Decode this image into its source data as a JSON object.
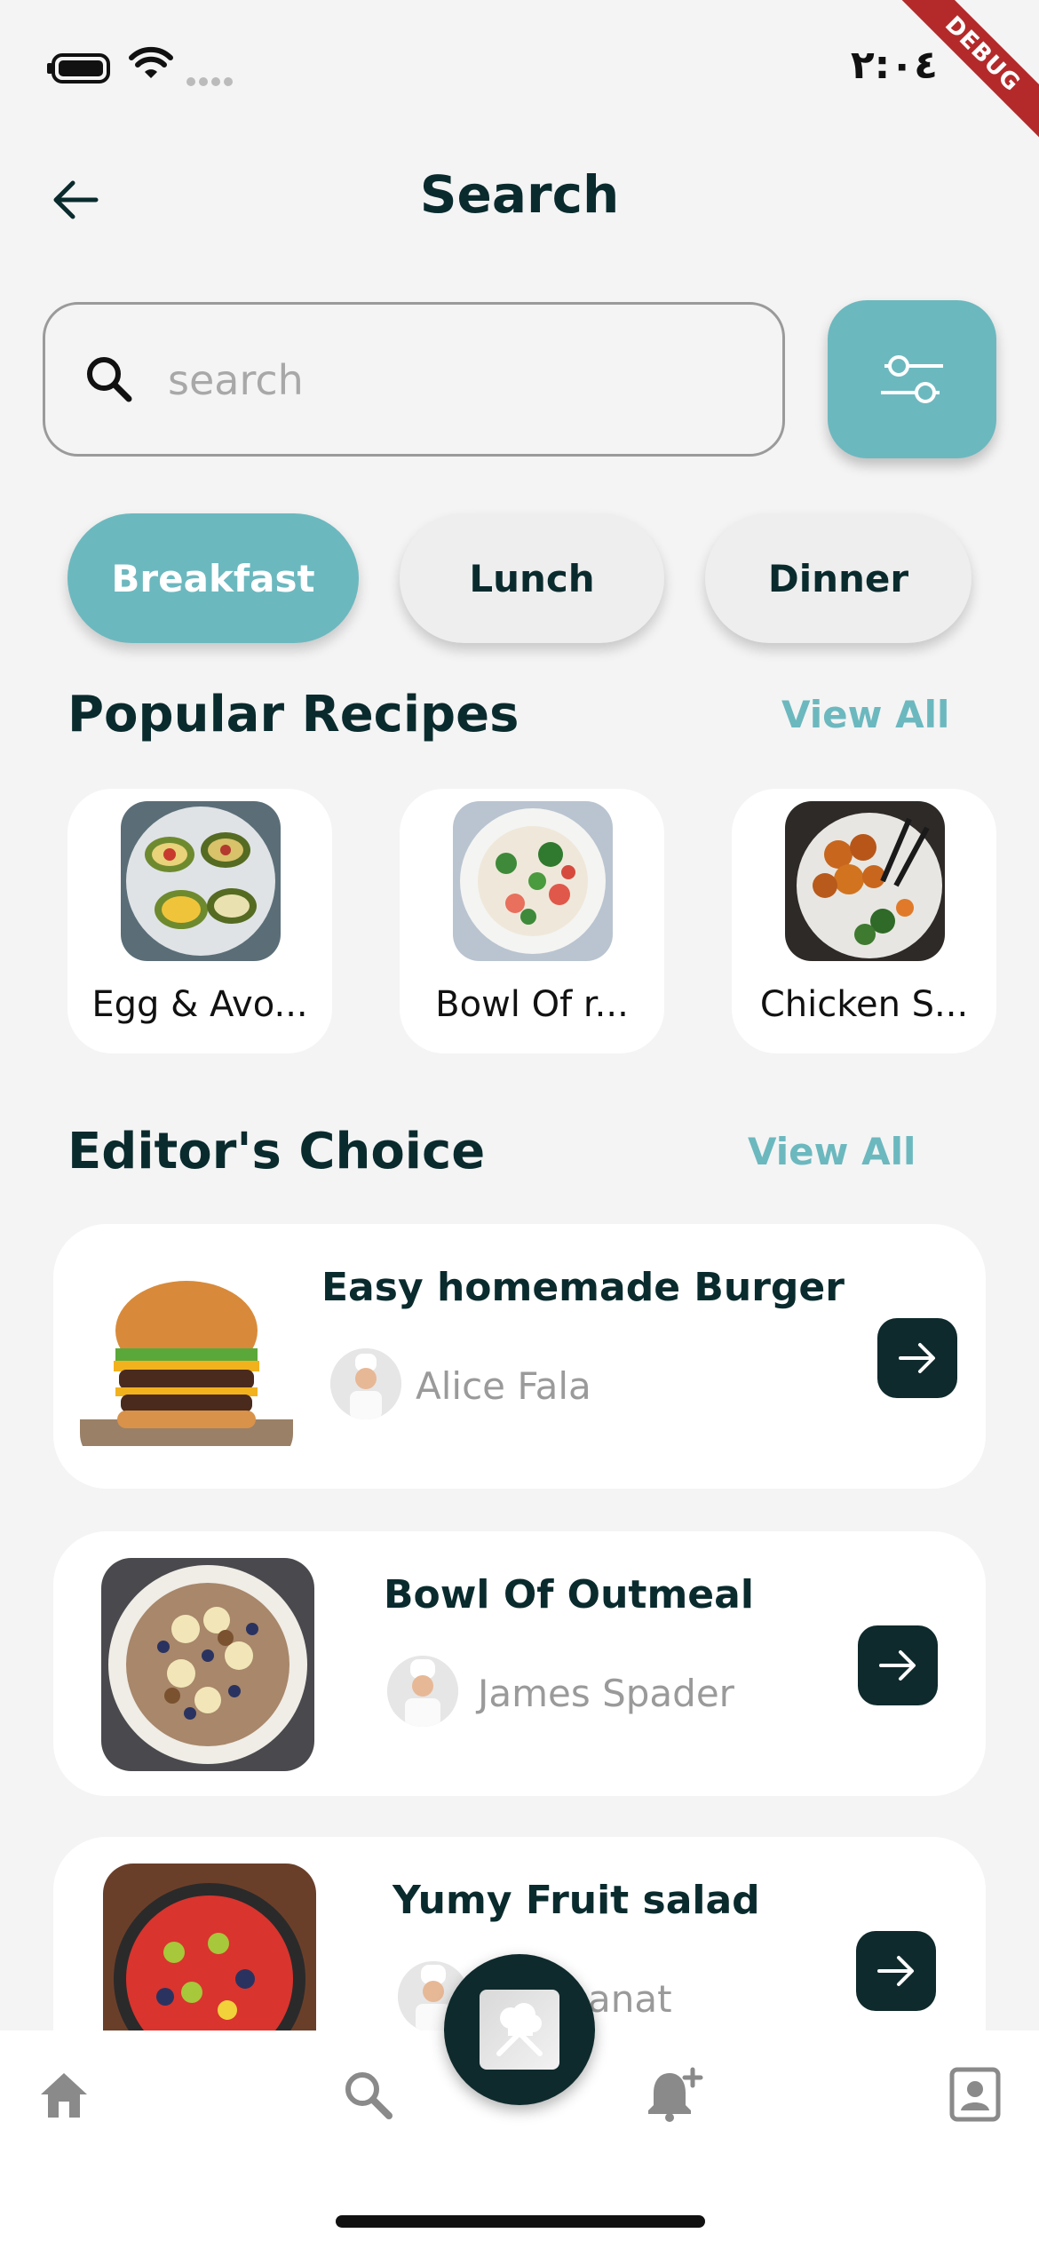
{
  "status_bar": {
    "time": "٢:٠٤",
    "debug_banner": "DEBUG"
  },
  "header": {
    "title": "Search",
    "back_icon": "arrow-left-icon"
  },
  "search": {
    "placeholder": "search",
    "value": ""
  },
  "categories": [
    {
      "label": "Breakfast",
      "active": true
    },
    {
      "label": "Lunch",
      "active": false
    },
    {
      "label": "Dinner",
      "active": false
    }
  ],
  "popular": {
    "title": "Popular Recipes",
    "view_all": "View All",
    "items": [
      {
        "label": "Egg & Avo..."
      },
      {
        "label": "Bowl Of r..."
      },
      {
        "label": "Chicken S..."
      }
    ]
  },
  "editors_choice": {
    "title": "Editor's Choice",
    "view_all": "View All",
    "items": [
      {
        "title": "Easy homemade Burger",
        "author": "Alice Fala"
      },
      {
        "title": "Bowl Of Outmeal",
        "author": "James Spader"
      },
      {
        "title": "Yumy Fruit salad",
        "author": "anat"
      }
    ]
  },
  "bottom_nav": {
    "items": [
      "home-icon",
      "search-icon",
      "notification-add-icon",
      "profile-icon"
    ],
    "fab_icon": "chef-icon"
  },
  "colors": {
    "accent": "#6cb8bf",
    "dark": "#0f2a2c",
    "background": "#f4f4f4"
  }
}
